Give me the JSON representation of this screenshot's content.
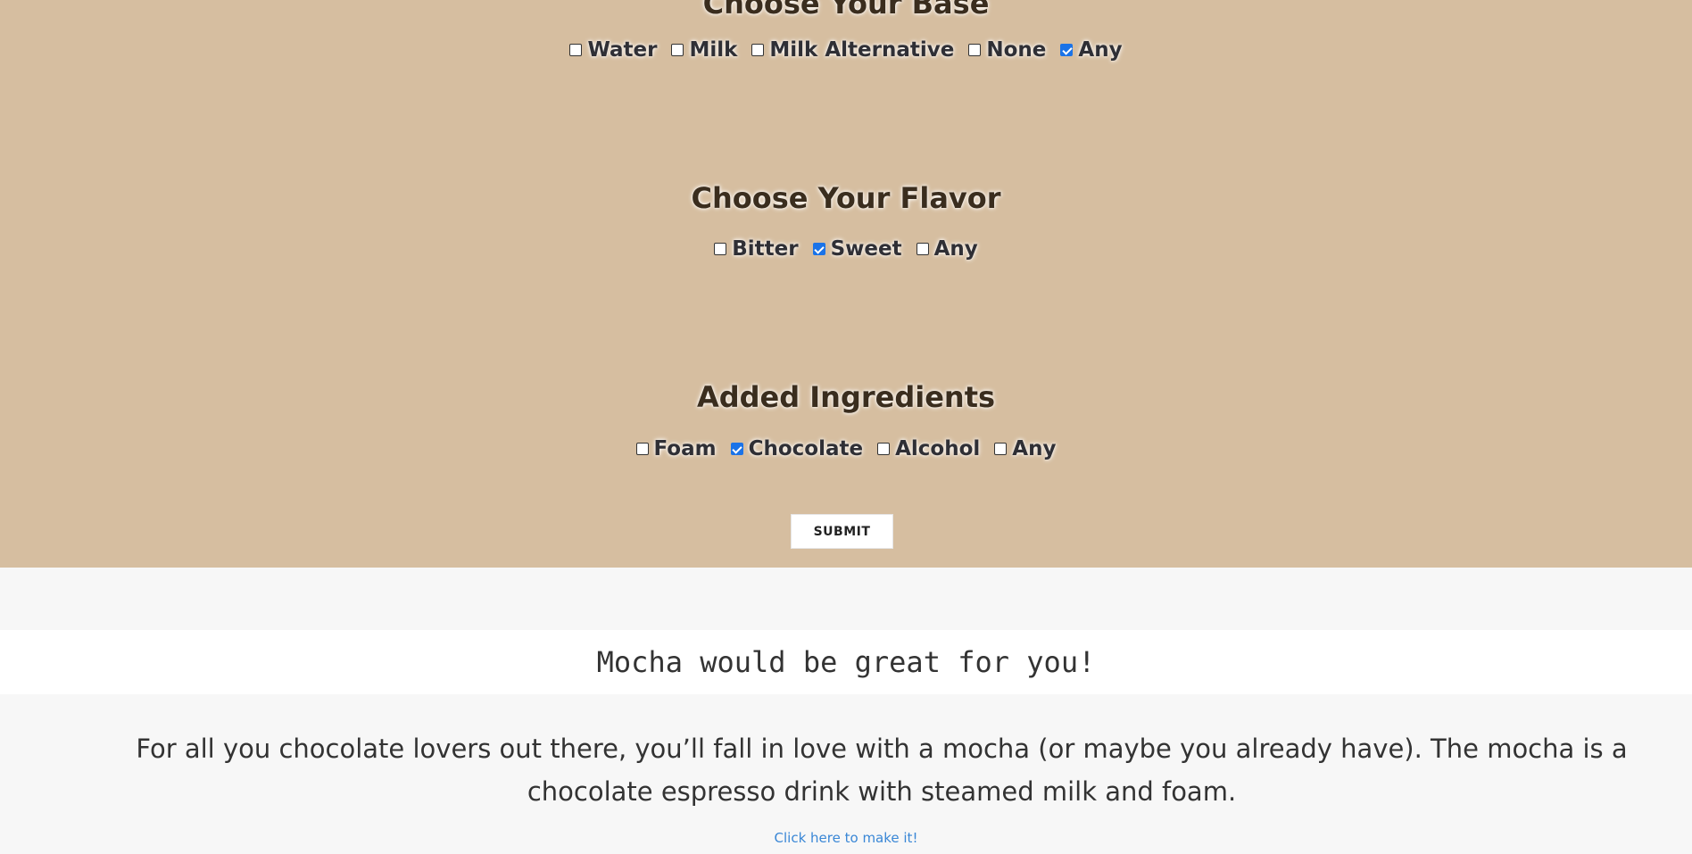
{
  "sections": [
    {
      "title": "Choose Your Base",
      "options": [
        {
          "label": "Water",
          "checked": false
        },
        {
          "label": "Milk",
          "checked": false
        },
        {
          "label": "Milk Alternative",
          "checked": false
        },
        {
          "label": "None",
          "checked": false
        },
        {
          "label": "Any",
          "checked": true
        }
      ]
    },
    {
      "title": "Choose Your Flavor",
      "options": [
        {
          "label": "Bitter",
          "checked": false
        },
        {
          "label": "Sweet",
          "checked": true
        },
        {
          "label": "Any",
          "checked": false
        }
      ]
    },
    {
      "title": "Added Ingredients",
      "options": [
        {
          "label": "Foam",
          "checked": false
        },
        {
          "label": "Chocolate",
          "checked": true
        },
        {
          "label": "Alcohol",
          "checked": false
        },
        {
          "label": "Any",
          "checked": false
        }
      ]
    }
  ],
  "submit_label": "SUBMIT",
  "result": {
    "title": "Mocha would be great for you!",
    "description": "For all you chocolate lovers out there, you’ll fall in love with a mocha (or maybe you already have). The mocha is a chocolate espresso drink with steamed milk and foam.",
    "link_text": "Click here to make it!"
  },
  "colors": {
    "form_background": "#d6bea0",
    "page_background": "#f7f7f7",
    "checkbox_checked": "#1a73e8",
    "link": "#3a87d6"
  }
}
